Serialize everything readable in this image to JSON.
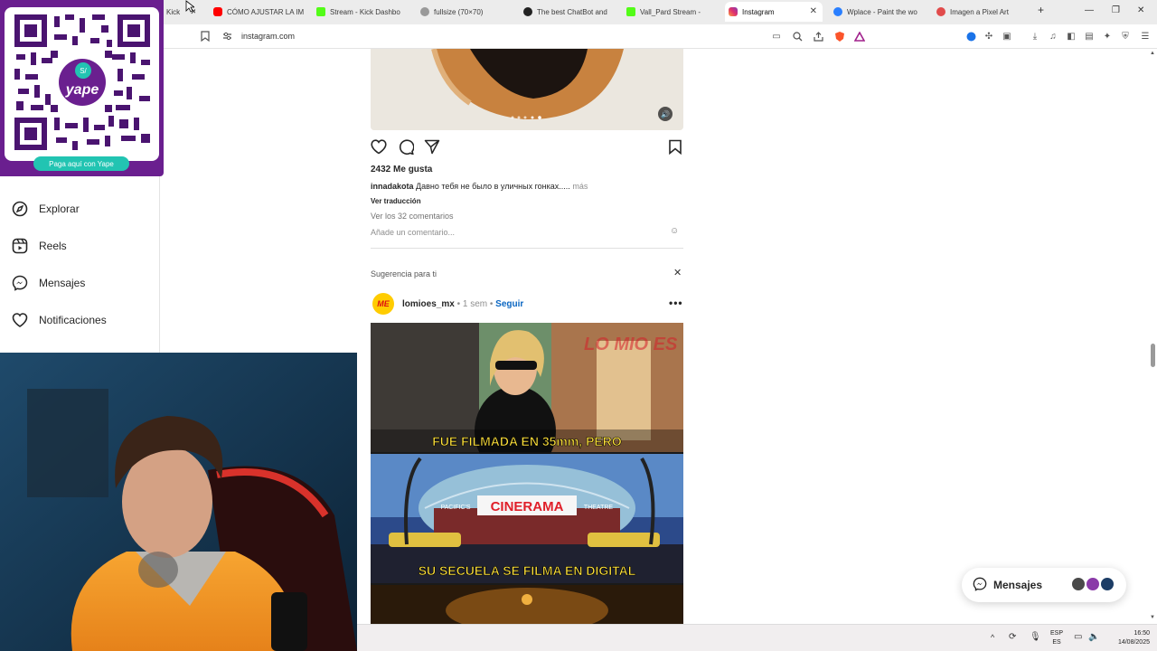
{
  "browser": {
    "tabs": [
      {
        "label": "Kick",
        "favicon": "kick-icon",
        "color": "#53fc18"
      },
      {
        "label": "CÓMO AJUSTAR LA IM",
        "favicon": "youtube-icon",
        "color": "#ff0000"
      },
      {
        "label": "Stream - Kick Dashbo",
        "favicon": "kick-icon",
        "color": "#53fc18"
      },
      {
        "label": "fullsize (70×70)",
        "favicon": "globe-icon",
        "color": "#777777"
      },
      {
        "label": "The best ChatBot and",
        "favicon": "github-icon",
        "color": "#222222"
      },
      {
        "label": "Vall_Pard Stream -",
        "favicon": "kick-icon",
        "color": "#53fc18"
      },
      {
        "label": "Instagram",
        "favicon": "instagram-icon",
        "color": "#e1306c"
      },
      {
        "label": "Wplace - Paint the wo",
        "favicon": "globe-icon",
        "color": "#2a7fff"
      },
      {
        "label": "Imagen a Pixel Art",
        "favicon": "pixel-icon",
        "color": "#e14b4b"
      }
    ],
    "url": "instagram.com"
  },
  "yape": {
    "pill": "Paga aquí con Yape",
    "brand": "yape",
    "badge": "S/",
    "color": "#6a1f8f"
  },
  "sidebar": {
    "items": [
      {
        "label": "Explorar",
        "icon": "compass-icon"
      },
      {
        "label": "Reels",
        "icon": "reels-icon"
      },
      {
        "label": "Mensajes",
        "icon": "messenger-icon"
      },
      {
        "label": "Notificaciones",
        "icon": "heart-icon"
      }
    ]
  },
  "post": {
    "likes": "2432 Me gusta",
    "username": "innadakota",
    "caption": "Давно тебя не было в уличных гонках.....",
    "more": "más",
    "translate": "Ver traducción",
    "comments": "Ver los 32 comentarios",
    "comment_placeholder": "Añade un comentario..."
  },
  "suggestion": {
    "heading": "Sugerencia para ti",
    "account": "lomioes_mx",
    "time": "1 sem",
    "follow": "Seguir",
    "avatar_text": "ME",
    "caption_top": "FUE FILMADA EN 35mm, PERO",
    "caption_bottom": "SU SECUELA SE FILMA EN DIGITAL",
    "cinema_sign": "CINERAMA",
    "cinema_small": "PACIFIC'S",
    "cinema_right": "THEATRE",
    "watermark": "LO MIO ES"
  },
  "messages_bubble": {
    "label": "Mensajes"
  },
  "taskbar": {
    "lang_top": "ESP",
    "lang_bottom": "ES",
    "time": "16:50",
    "date": "14/08/2025"
  }
}
